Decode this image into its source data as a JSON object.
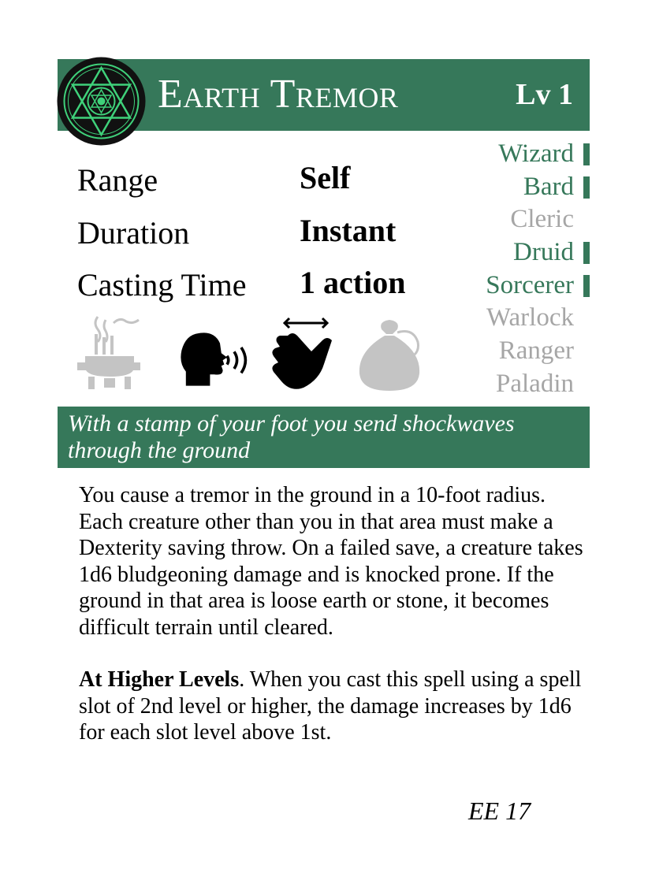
{
  "header": {
    "title": "Earth Tremor",
    "level": "Lv 1",
    "emblem_icon": "hexagram-emblem-icon"
  },
  "stats": {
    "range_label": "Range",
    "range_value": "Self",
    "duration_label": "Duration",
    "duration_value": "Instant",
    "casting_time_label": "Casting Time",
    "casting_time_value": "1 action"
  },
  "classes": [
    {
      "name": "Wizard",
      "active": true
    },
    {
      "name": "Bard",
      "active": true
    },
    {
      "name": "Cleric",
      "active": false
    },
    {
      "name": "Druid",
      "active": true
    },
    {
      "name": "Sorcerer",
      "active": true
    },
    {
      "name": "Warlock",
      "active": false
    },
    {
      "name": "Ranger",
      "active": false
    },
    {
      "name": "Paladin",
      "active": false
    }
  ],
  "components": [
    {
      "name": "ritual",
      "icon": "incense-burner-icon",
      "active": false
    },
    {
      "name": "verbal",
      "icon": "speaking-head-icon",
      "active": true
    },
    {
      "name": "somatic",
      "icon": "snapping-hand-icon",
      "active": true
    },
    {
      "name": "material",
      "icon": "pouch-icon",
      "active": false
    }
  ],
  "colors": {
    "accent": "#36785a",
    "inactive": "#a6a6a6"
  },
  "flavor": "With a stamp of your foot you send shockwaves through the ground",
  "description": {
    "body": "You cause a tremor in the ground in a 10-foot radius. Each creature other than you in that area must make a Dexterity saving throw. On a failed save, a creature takes 1d6 bludgeoning damage and is knocked prone. If the ground in that area is loose earth or stone, it becomes difficult terrain until cleared.",
    "higher_label": "At Higher Levels",
    "higher_text": ". When you cast this spell using a spell slot of 2nd level or higher, the damage increases by 1d6 for each slot level above 1st."
  },
  "source": "EE 17"
}
